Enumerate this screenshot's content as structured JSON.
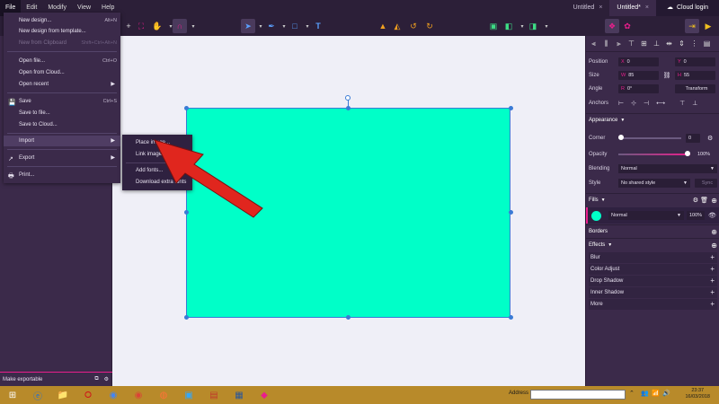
{
  "menubar": {
    "items": [
      "File",
      "Edit",
      "Modify",
      "View",
      "Help"
    ]
  },
  "tabs": [
    {
      "label": "Untitled"
    },
    {
      "label": "Untitled*"
    }
  ],
  "cloud_login": "Cloud login",
  "file_menu": {
    "items": [
      {
        "label": "New design...",
        "shortcut": "Alt+N"
      },
      {
        "label": "New design from template...",
        "shortcut": ""
      },
      {
        "label": "New from Clipboard",
        "shortcut": "Shift+Ctrl+Alt+N"
      },
      {
        "label": "Open file...",
        "shortcut": "Ctrl+O"
      },
      {
        "label": "Open from Cloud...",
        "shortcut": ""
      },
      {
        "label": "Open recent",
        "shortcut": ""
      },
      {
        "label": "Save",
        "shortcut": "Ctrl+S"
      },
      {
        "label": "Save to file...",
        "shortcut": ""
      },
      {
        "label": "Save to Cloud...",
        "shortcut": ""
      },
      {
        "label": "Import",
        "shortcut": ""
      },
      {
        "label": "Export",
        "shortcut": ""
      },
      {
        "label": "Print...",
        "shortcut": ""
      }
    ]
  },
  "import_submenu": {
    "items": [
      "Place image...",
      "Link image...",
      "Add fonts...",
      "Download extra fonts"
    ]
  },
  "left_footer": {
    "label": "Make exportable"
  },
  "properties": {
    "position_label": "Position",
    "x_key": "X",
    "x_value": "0",
    "y_key": "Y",
    "y_value": "0",
    "size_label": "Size",
    "w_key": "W",
    "w_value": "85",
    "h_key": "H",
    "h_value": "55",
    "angle_label": "Angle",
    "angle_key": "R",
    "angle_value": "0°",
    "transform_button": "Transform",
    "anchors_label": "Anchors"
  },
  "appearance": {
    "title": "Appearance",
    "corner_label": "Corner",
    "corner_value": "0",
    "opacity_label": "Opacity",
    "opacity_value": "100%",
    "opacity_level": 1.0,
    "blending_label": "Blending",
    "blending_value": "Normal",
    "style_label": "Style",
    "style_value": "No shared style",
    "sync_button": "Sync"
  },
  "fills": {
    "title": "Fills",
    "color": "#00ffc8",
    "blend": "Normal",
    "opacity": "100%"
  },
  "borders": {
    "title": "Borders"
  },
  "effects": {
    "title": "Effects",
    "items": [
      "Blur",
      "Color Adjust",
      "Drop Shadow",
      "Inner Shadow",
      "More"
    ]
  },
  "taskbar": {
    "address_label": "Address",
    "time": "23:37",
    "date": "16/03/2018"
  },
  "colors": {
    "accent": "#e91e8c",
    "shape_fill": "#00ffc8",
    "selection": "#3a7bd5",
    "arrow_red": "#e0261e"
  }
}
